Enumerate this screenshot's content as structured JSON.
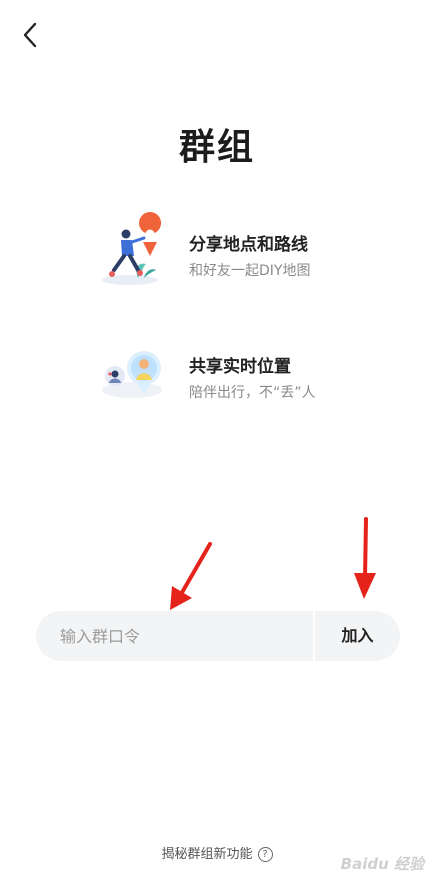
{
  "header": {
    "title": "群组"
  },
  "features": [
    {
      "title": "分享地点和路线",
      "desc": "和好友一起DIY地图"
    },
    {
      "title": "共享实时位置",
      "desc": "陪伴出行，不“丢”人"
    }
  ],
  "join": {
    "placeholder": "输入群口令",
    "value": "",
    "button_label": "加入"
  },
  "footer": {
    "link_label": "揭秘群组新功能",
    "help_symbol": "?"
  },
  "watermark": {
    "text": "Baidu 经验"
  },
  "colors": {
    "arrow": "#e5231b",
    "input_bg": "#f3f4f6",
    "accent_orange": "#f0643c"
  },
  "icons": [
    "back-arrow-icon",
    "share-route-illustration",
    "live-location-illustration",
    "help-icon",
    "red-pointer-arrow"
  ]
}
